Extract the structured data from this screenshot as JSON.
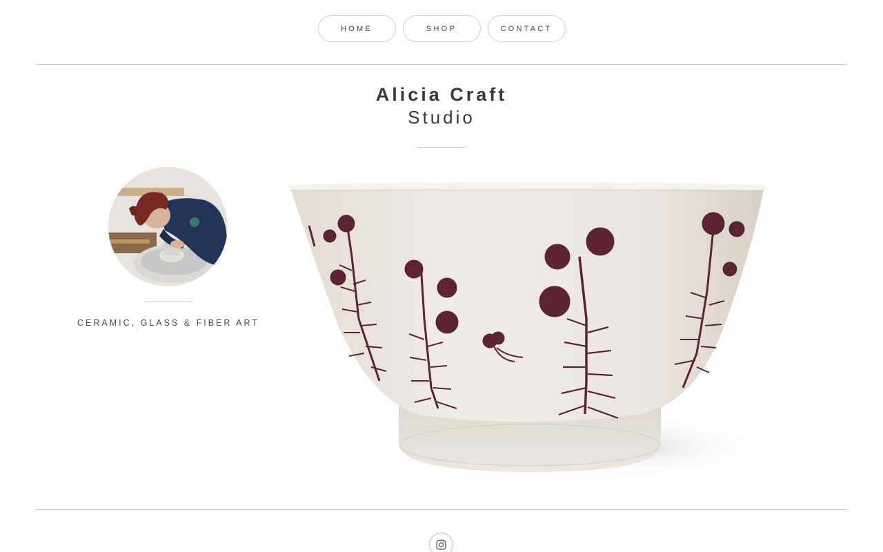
{
  "nav": {
    "items": [
      {
        "label": "HOME"
      },
      {
        "label": "SHOP"
      },
      {
        "label": "CONTACT"
      }
    ]
  },
  "site": {
    "title_line1": "Alicia Craft",
    "title_line2": "Studio"
  },
  "profile": {
    "tagline": "CERAMIC, GLASS & FIBER ART"
  },
  "footer": {
    "social_icon": "instagram-icon"
  },
  "colors": {
    "border": "#cfcfcf",
    "text": "#3a3a3a",
    "glaze": "#efebe3",
    "decal": "#5a2430"
  }
}
